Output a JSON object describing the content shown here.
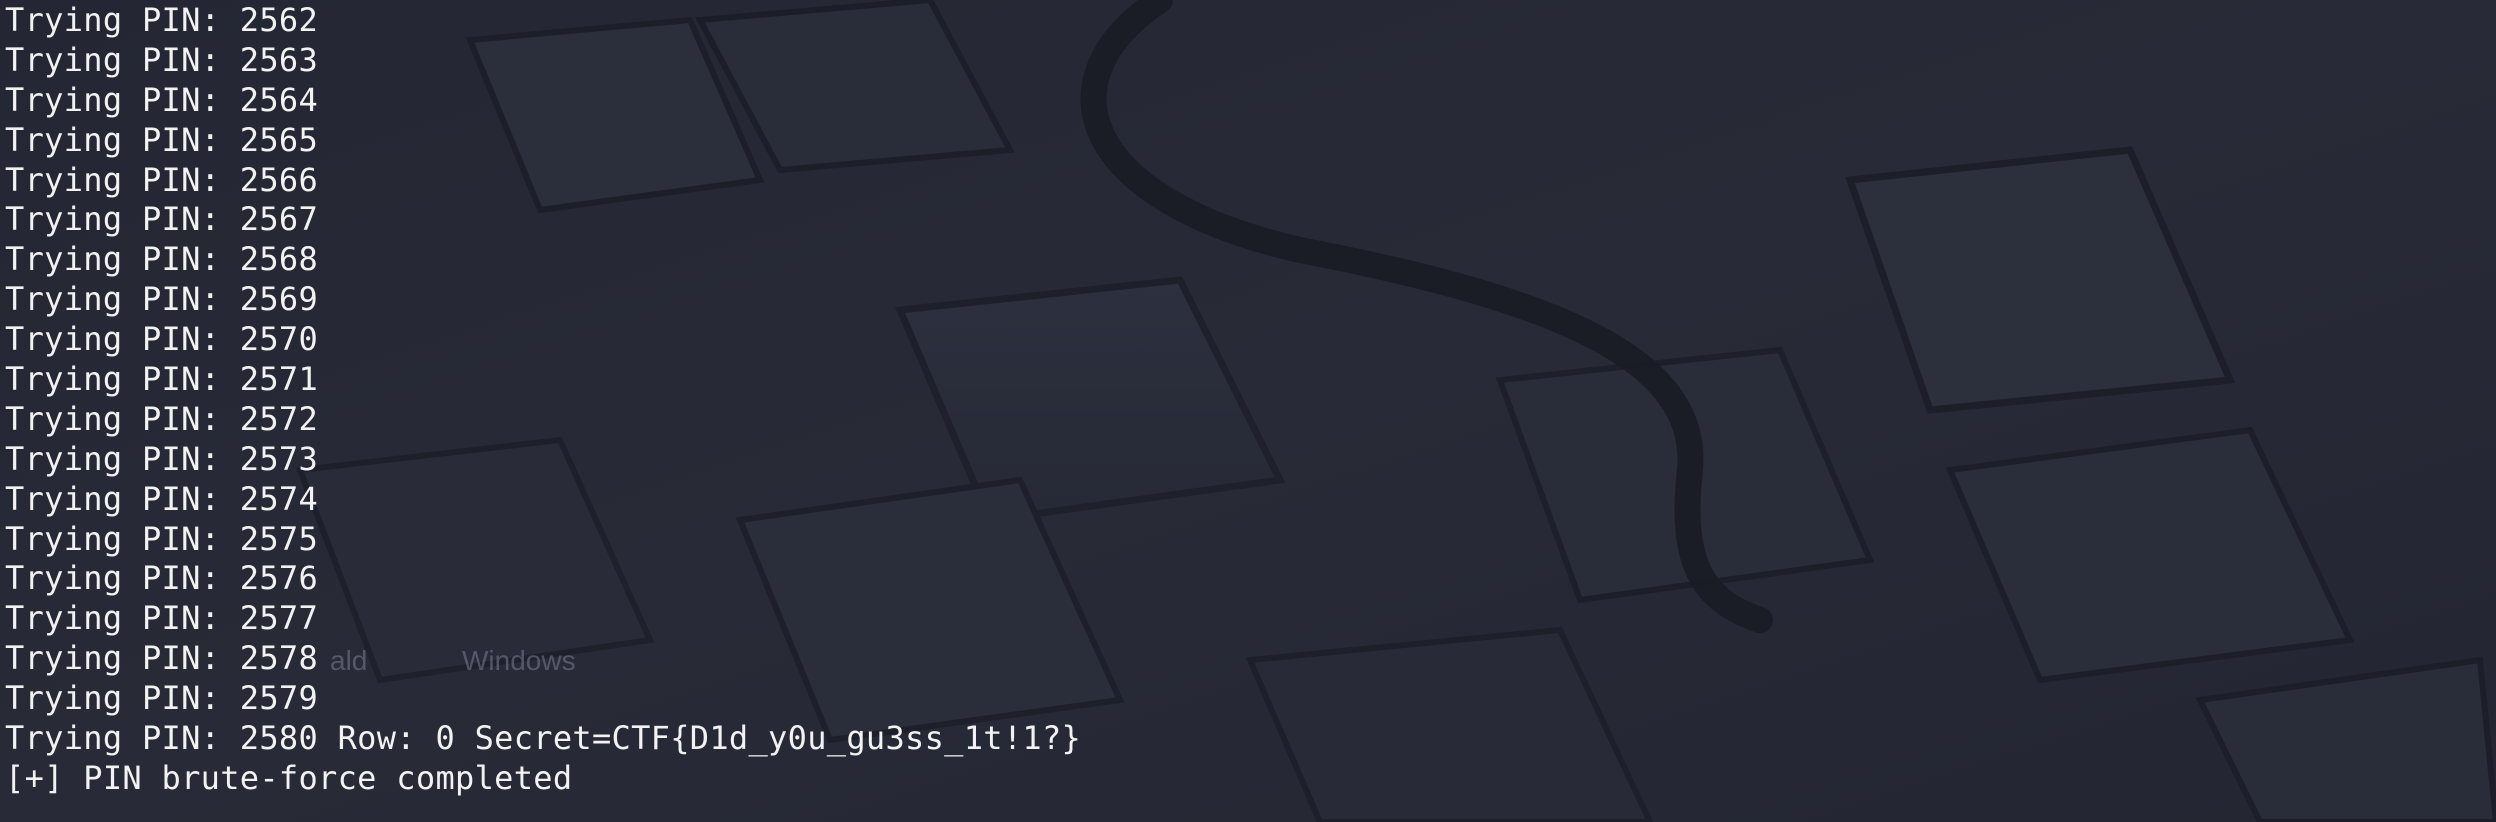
{
  "terminal": {
    "lines": [
      "Trying PIN: 2562",
      "Trying PIN: 2563",
      "Trying PIN: 2564",
      "Trying PIN: 2565",
      "Trying PIN: 2566",
      "Trying PIN: 2567",
      "Trying PIN: 2568",
      "Trying PIN: 2569",
      "Trying PIN: 2570",
      "Trying PIN: 2571",
      "Trying PIN: 2572",
      "Trying PIN: 2573",
      "Trying PIN: 2574",
      "Trying PIN: 2575",
      "Trying PIN: 2576",
      "Trying PIN: 2577",
      "Trying PIN: 2578",
      "Trying PIN: 2579",
      "Trying PIN: 2580 Row: 0 Secret=CTF{D1d_y0u_gu3ss_1t!1?}",
      "[+] PIN brute-force completed"
    ],
    "text_color": "#f2f2f2",
    "background_color": "#252834"
  },
  "wallpaper": {
    "subject": "dark keyboard keys with cable",
    "watermark_fragments": [
      "ald",
      "Windows"
    ]
  }
}
